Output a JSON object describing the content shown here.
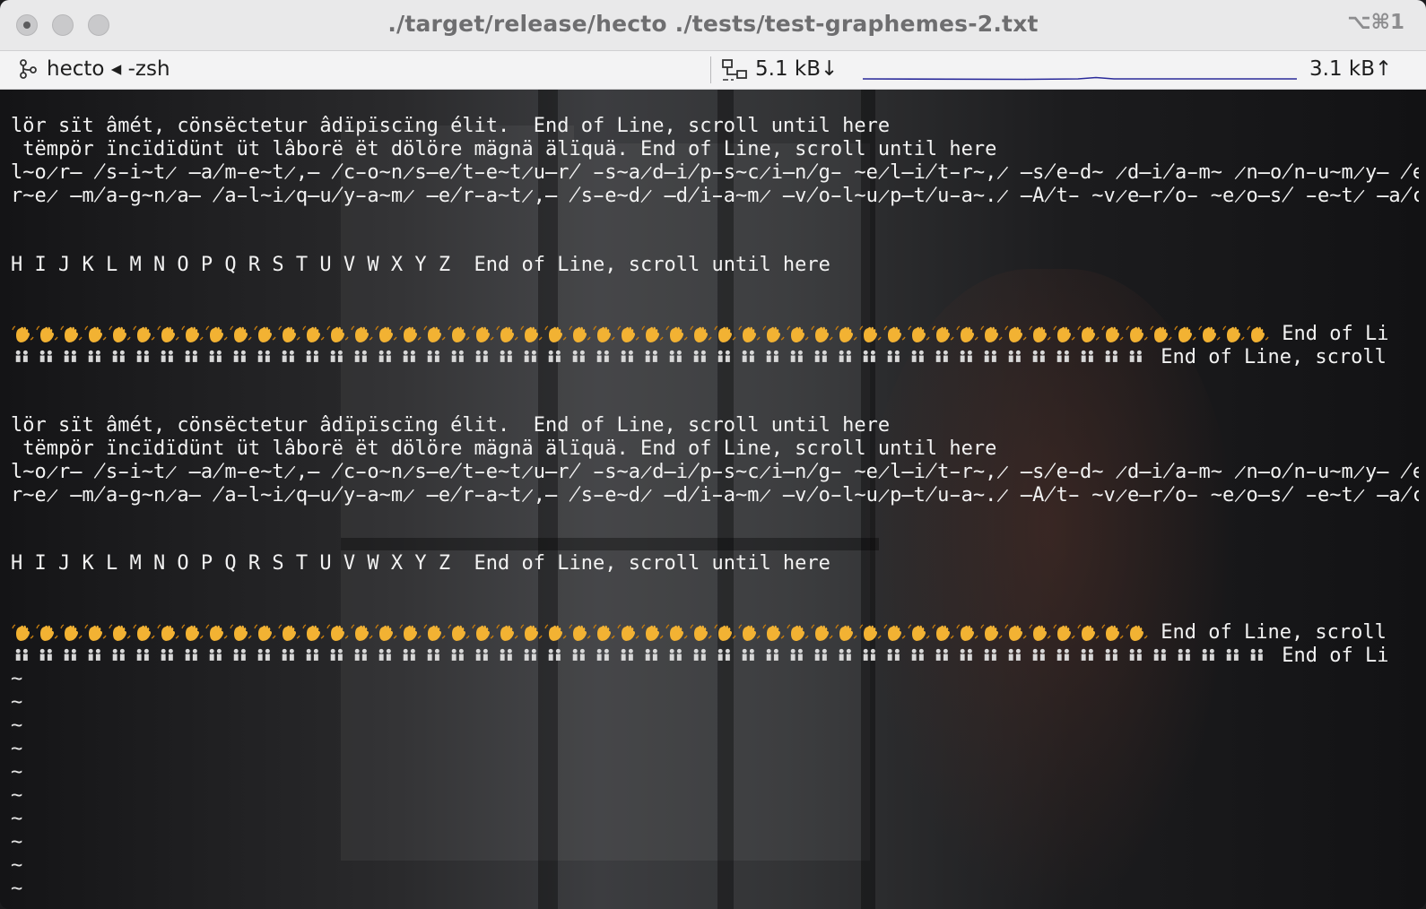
{
  "window": {
    "title": "./target/release/hecto ./tests/test-graphemes-2.txt",
    "shortcut": "⌥⌘1"
  },
  "tabbar": {
    "tab_label": "hecto ◂ -zsh",
    "net_down": "5.1 kB↓",
    "net_up": "3.1 kB↑"
  },
  "editor": {
    "block1": {
      "l1": "lör sït âmét, cönsëctetur âdïpïscïng élit.  End of Line, scroll until here",
      "l2": " tëmpör ïncïdïdünt üt lâborë ët dölöre mägnä älïquä. End of Line, scroll until here",
      "l3": "l̴o̷r̶ ̸s̵i̴t̷ ̶a̸m̵e̴t̷,̶ ̸c̵o̴n̷s̶e̸t̵e̴t̷u̶r̸ ̵s̴a̷d̶i̸p̵s̴c̷i̶n̸g̵ ̴e̷l̶i̸t̵r̴,̷ ̶s̸e̵d̴ ̷d̶i̸a̵m̴ ̷n̶o̸n̵u̴m̷y̶ ̸e̵i̴r̷m̶o̸d̵ ̴t̷e̶m̸p̵o̴r̷ ̶i̸n̵v̴i̷d̶u̸n̵t̴ ̷u̶t̸  End of Line, scroll until",
      "l4": "r̴e̷ ̶m̸a̵g̴n̷a̶ ̸a̵l̴i̷q̶u̸y̵a̴m̷ ̶e̸r̵a̴t̷,̶ ̸s̵e̴d̷ ̶d̸i̵a̴m̷ ̶v̸o̵l̴u̷p̶t̸u̵a̴.̷ ̶A̸t̵ ̴v̷e̶r̸o̵ ̴e̷o̶s̸ ̵e̴t̷ ̶a̸c̵c̴u̷s̶a̸m̵ ̴e̷t̶ ̸j̵u̴s̷t̶o̸ ̵d̴u̷o̶ ̸d̵o̴l̷o̶r̸e̵s End of Line, scroll until",
      "l5": "H I J K L M N O P Q R S T U V W X Y Z  End of Line, scroll until here",
      "l6_suffix": " End of Li",
      "l7_suffix": " End of Line, scroll"
    },
    "block2": {
      "l1": "lör sït âmét, cönsëctetur âdïpïscïng élit.  End of Line, scroll until here",
      "l2": " tëmpör ïncïdïdünt üt lâborë ët dölöre mägnä älïquä. End of Line, scroll until here",
      "l3": "l̴o̷r̶ ̸s̵i̴t̷ ̶a̸m̵e̴t̷,̶ ̸c̵o̴n̷s̶e̸t̵e̴t̷u̶r̸ ̵s̴a̷d̶i̸p̵s̴c̷i̶n̸g̵ ̴e̷l̶i̸t̵r̴,̷ ̶s̸e̵d̴ ̷d̶i̸a̵m̴ ̷n̶o̸n̵u̴m̷y̶ ̸e̵i̴r̷m̶o̸d̵ ̴t̷e̶m̸p̵o̴r̷ ̶i̸n̵v̴i̷d̶u̸n̵t̴ ̷u̶t̸  End of Line, scroll until",
      "l4": "r̴e̷ ̶m̸a̵g̴n̷a̶ ̸a̵l̴i̷q̶u̸y̵a̴m̷ ̶e̸r̵a̴t̷,̶ ̸s̵e̴d̷ ̶d̸i̵a̴m̷ ̶v̸o̵l̴u̷p̶t̸u̵a̴.̷ ̶A̸t̵ ̴v̷e̶r̸o̵ ̴e̷o̶s̸ ̵e̴t̷ ̶a̸c̵c̴u̷s̶a̸m̵ ̴e̷t̶ ̸j̵u̴s̷t̶o̸ ̵d̴u̷o̶ ̸d̵o̴l̷o̶r̸e̵s End of Line, scroll until",
      "l5": "H I J K L M N O P Q R S T U V W X Y Z  End of Line, scroll until here",
      "l6_suffix": " End of Line, scroll",
      "l7_suffix": " End of Li"
    },
    "tilde": "~",
    "colors": {
      "wave": "#f2b233",
      "people": "#d8d8d8",
      "text": "#f2f2f2"
    }
  }
}
